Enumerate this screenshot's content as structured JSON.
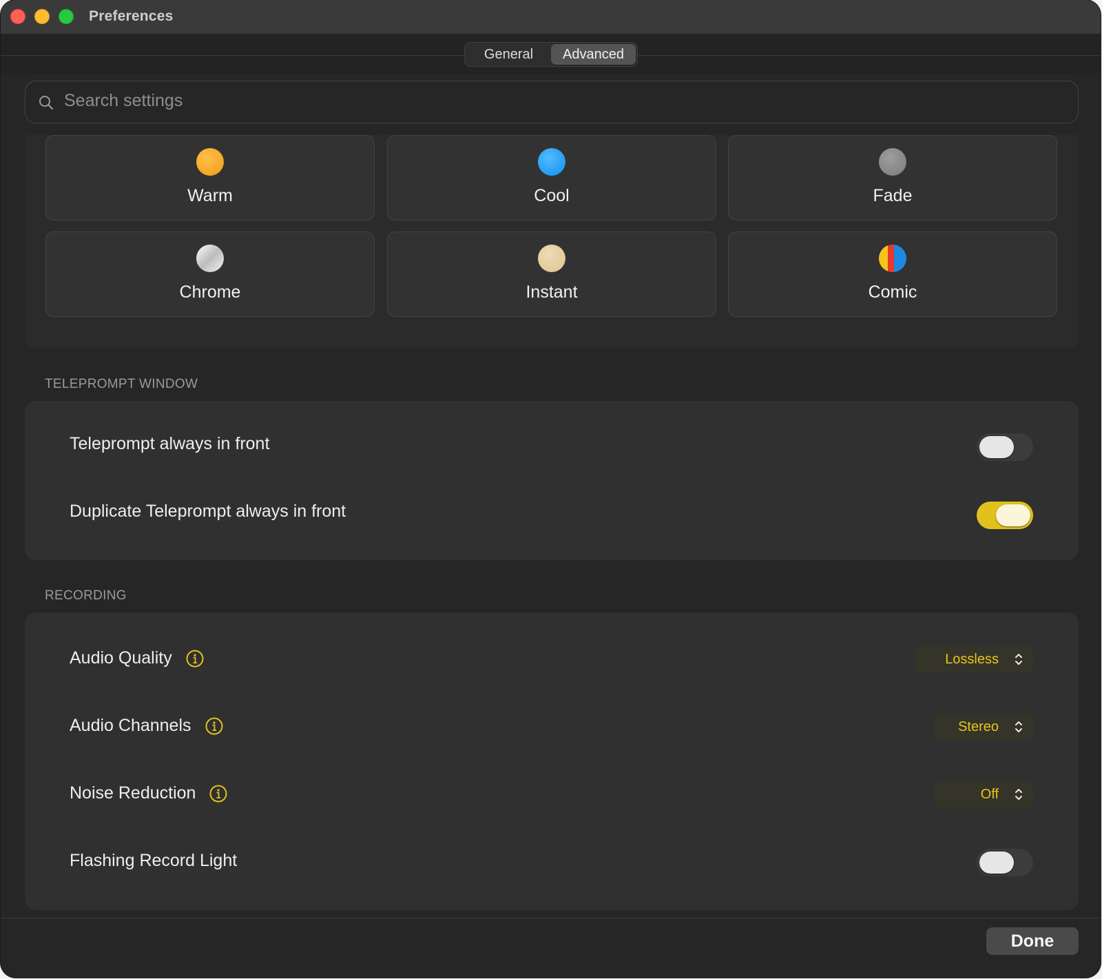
{
  "window": {
    "title": "Preferences"
  },
  "tabs": [
    {
      "label": "General",
      "active": false
    },
    {
      "label": "Advanced",
      "active": true
    }
  ],
  "search": {
    "placeholder": "Search settings"
  },
  "filters": [
    {
      "label": "Warm",
      "color": "#f6a21f"
    },
    {
      "label": "Cool",
      "color": "#1f9bf2"
    },
    {
      "label": "Fade",
      "color": "#8a8a8a"
    },
    {
      "label": "Chrome",
      "color": "#e2e2e2"
    },
    {
      "label": "Instant",
      "color": "#e4cfa0"
    },
    {
      "label": "Comic",
      "colors": [
        "#f5c518",
        "#e8392c",
        "#1e88e5"
      ]
    }
  ],
  "teleprompt": {
    "heading": "TELEPROMPT WINDOW",
    "rows": [
      {
        "label": "Teleprompt always in front",
        "on": false
      },
      {
        "label": "Duplicate Teleprompt always in front",
        "on": true
      }
    ]
  },
  "recording": {
    "heading": "RECORDING",
    "audio_quality": {
      "label": "Audio Quality",
      "value": "Lossless"
    },
    "audio_channels": {
      "label": "Audio Channels",
      "value": "Stereo"
    },
    "noise_reduction": {
      "label": "Noise Reduction",
      "value": "Off"
    },
    "flashing_light": {
      "label": "Flashing Record Light",
      "on": false
    }
  },
  "footer": {
    "done_label": "Done"
  },
  "colors": {
    "accent": "#e2c11e",
    "background": "#262626"
  }
}
